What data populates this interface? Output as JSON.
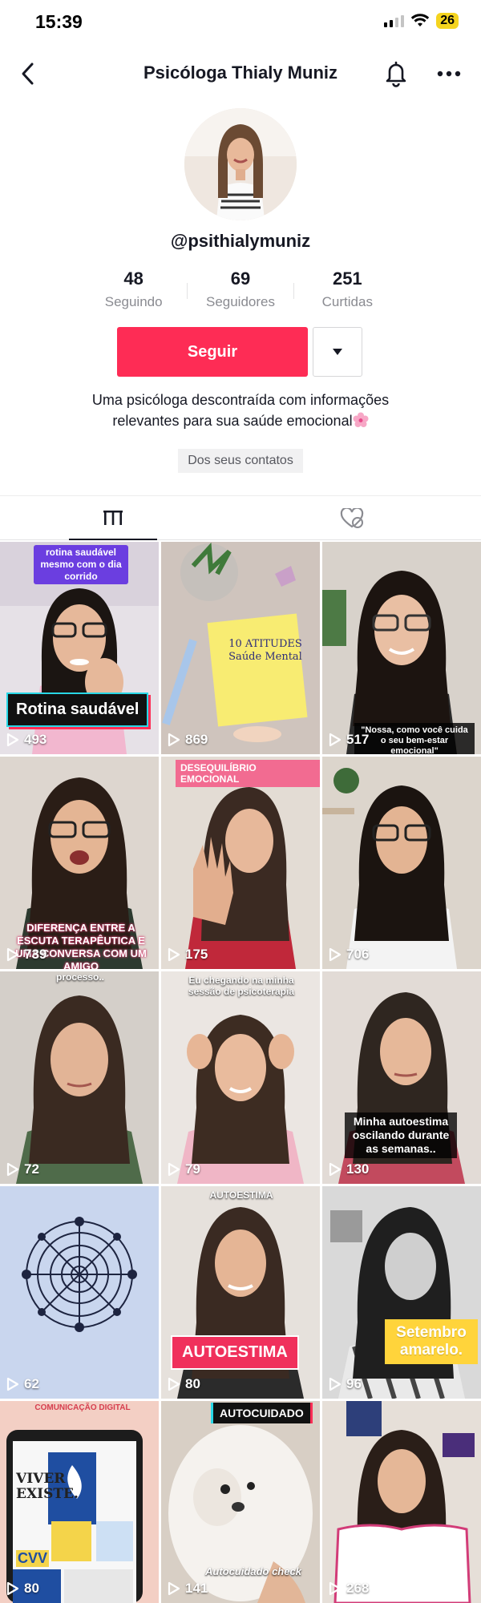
{
  "status_bar": {
    "time": "15:39",
    "battery": "26"
  },
  "header": {
    "title": "Psicóloga Thialy Muniz"
  },
  "profile": {
    "handle": "@psithialymuniz",
    "stats": [
      {
        "value": "48",
        "label": "Seguindo"
      },
      {
        "value": "69",
        "label": "Seguidores"
      },
      {
        "value": "251",
        "label": "Curtidas"
      }
    ],
    "follow_label": "Seguir",
    "bio_line1": "Uma psicóloga descontraída com informações",
    "bio_line2": "relevantes para sua saúde emocional",
    "contacts_badge": "Dos seus contatos"
  },
  "videos": [
    {
      "views": "493",
      "caption_top": "rotina saudável mesmo com o dia corrido",
      "caption_main": "Rotina saudável"
    },
    {
      "views": "869",
      "note": "10 ATITUDES Saúde Mental"
    },
    {
      "views": "517",
      "caption": "\"Nossa, como você cuida o seu bem-estar emocional\""
    },
    {
      "views": "739",
      "caption": "DIFERENÇA ENTRE A ESCUTA TERAPÊUTICA E UMA CONVERSA COM UM AMIGO"
    },
    {
      "views": "175",
      "caption": "DESEQUILÍBRIO EMOCIONAL"
    },
    {
      "views": "706"
    },
    {
      "views": "72",
      "caption": "processo.."
    },
    {
      "views": "79",
      "caption": "Eu chegando na minha sessão de psicoterapia"
    },
    {
      "views": "130",
      "caption": "Minha autoestima oscilando durante as semanas.."
    },
    {
      "views": "62"
    },
    {
      "views": "80",
      "caption_top": "AUTOESTIMA",
      "caption_main": "AUTOESTIMA"
    },
    {
      "views": "96",
      "caption": "Setembro amarelo."
    },
    {
      "views": "80",
      "caption_top": "COMUNICAÇÃO DIGITAL",
      "poster1": "VIVER EXISTE.",
      "poster2": "CVV"
    },
    {
      "views": "141",
      "caption": "AUTOCUIDADO",
      "caption_bottom": "Autocuidado check"
    },
    {
      "views": "268"
    }
  ],
  "colors": {
    "accent": "#fe2c55",
    "text": "#161823",
    "muted": "#8a8b91"
  }
}
